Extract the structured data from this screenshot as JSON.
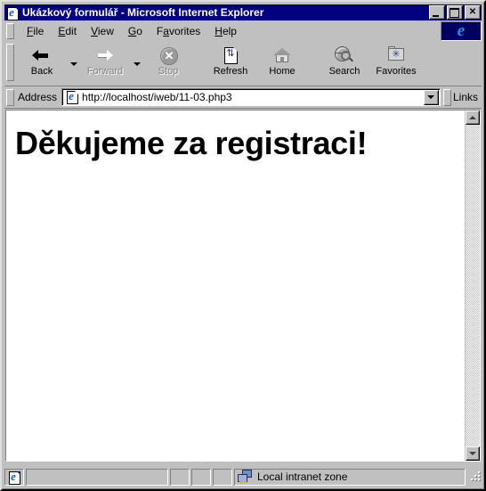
{
  "window": {
    "title": "Ukázkový formulář - Microsoft Internet Explorer",
    "title_icon": "ie-document-icon",
    "controls": {
      "minimize_label": "_",
      "maximize_label": "□",
      "close_label": "✕"
    },
    "colors": {
      "titlebar": "#000080",
      "face": "#c0c0c0",
      "content_bg": "#ffffff",
      "logo_bg": "#000061",
      "ie_blue": "#2d8fe8"
    }
  },
  "menubar": {
    "items": [
      {
        "label": "File",
        "accel": "F"
      },
      {
        "label": "Edit",
        "accel": "E"
      },
      {
        "label": "View",
        "accel": "V"
      },
      {
        "label": "Go",
        "accel": "G"
      },
      {
        "label": "Favorites",
        "accel": "a"
      },
      {
        "label": "Help",
        "accel": "H"
      }
    ],
    "logo_glyph": "e"
  },
  "toolbar": {
    "buttons": [
      {
        "label": "Back",
        "icon": "arrow-left-icon",
        "enabled": true,
        "has_dropdown": true
      },
      {
        "label": "Forward",
        "icon": "arrow-right-icon",
        "enabled": false,
        "has_dropdown": true
      },
      {
        "label": "Stop",
        "icon": "stop-icon",
        "enabled": false,
        "has_dropdown": false
      },
      {
        "label": "Refresh",
        "icon": "refresh-icon",
        "enabled": true,
        "has_dropdown": false
      },
      {
        "label": "Home",
        "icon": "home-icon",
        "enabled": true,
        "has_dropdown": false
      },
      {
        "label": "Search",
        "icon": "search-icon",
        "enabled": true,
        "has_dropdown": false
      },
      {
        "label": "Favorites",
        "icon": "favorites-folder-icon",
        "enabled": true,
        "has_dropdown": false
      }
    ],
    "stop_glyph": "✕",
    "refresh_glyph": "⇅",
    "star_glyph": "✳"
  },
  "addressbar": {
    "label": "Address",
    "url": "http://localhost/iweb/11-03.php3",
    "placeholder": "",
    "icon": "ie-document-icon",
    "dropdown_icon": "chevron-down-icon",
    "links_label": "Links"
  },
  "page": {
    "heading": "Děkujeme za registraci!"
  },
  "scrollbar": {
    "up_icon": "caret-up-icon",
    "down_icon": "caret-down-icon"
  },
  "statusbar": {
    "icon": "ie-document-icon",
    "message": "",
    "zone_label": "Local intranet zone",
    "zone_icon": "network-computers-icon"
  }
}
